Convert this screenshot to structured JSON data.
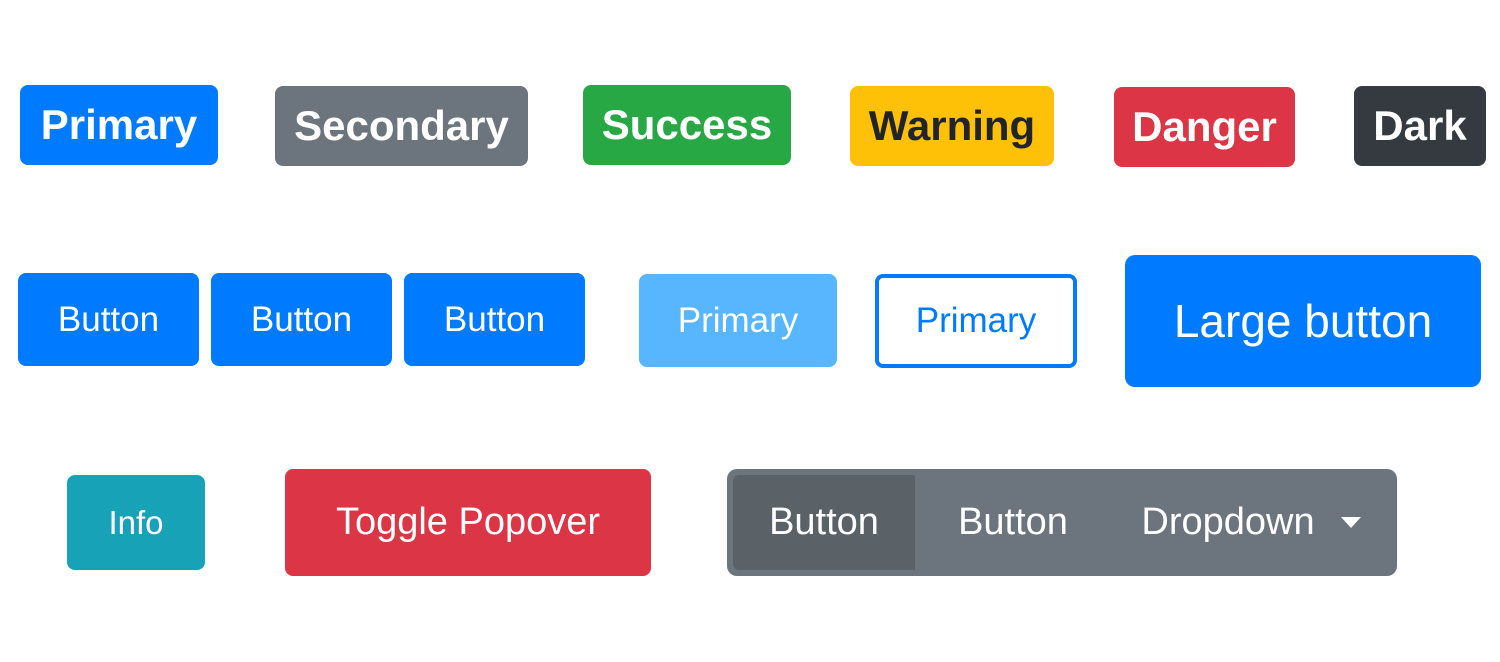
{
  "row1": {
    "primary": "Primary",
    "secondary": "Secondary",
    "success": "Success",
    "warning": "Warning",
    "danger": "Danger",
    "dark": "Dark"
  },
  "row2": {
    "button1": "Button",
    "button2": "Button",
    "button3": "Button",
    "primary_disabled": "Primary",
    "primary_outline": "Primary",
    "large": "Large button"
  },
  "row3": {
    "info": "Info",
    "toggle_popover": "Toggle Popover",
    "group": {
      "button1": "Button",
      "button2": "Button",
      "dropdown": "Dropdown"
    }
  },
  "colors": {
    "primary": "#007bff",
    "secondary": "#6c757d",
    "success": "#28a745",
    "warning": "#ffc107",
    "danger": "#dc3545",
    "dark": "#343a40",
    "info": "#17a2b8",
    "primary_disabled": "#58b5ff"
  }
}
